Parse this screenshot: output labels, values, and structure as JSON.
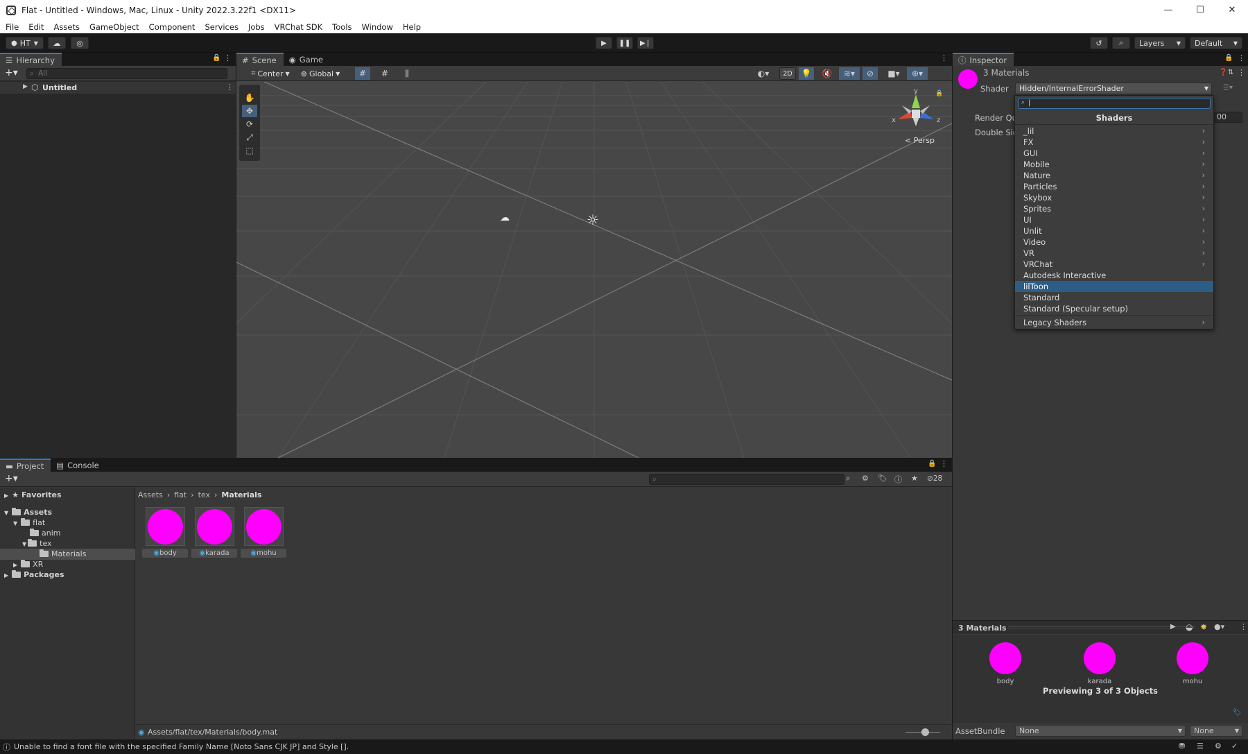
{
  "window": {
    "title": "Flat - Untitled - Windows, Mac, Linux - Unity 2022.3.22f1 <DX11>",
    "controls": [
      "—",
      "☐",
      "✕"
    ]
  },
  "menubar": [
    "File",
    "Edit",
    "Assets",
    "GameObject",
    "Component",
    "Services",
    "Jobs",
    "VRChat SDK",
    "Tools",
    "Window",
    "Help"
  ],
  "toolbar": {
    "account": "HT",
    "layers": "Layers",
    "layout": "Default"
  },
  "hierarchy": {
    "tab": "Hierarchy",
    "search_placeholder": "All",
    "scene": "Untitled"
  },
  "scene": {
    "tabs": [
      "Scene",
      "Game"
    ],
    "pivot": "Center",
    "space": "Global",
    "mode_2d": "2D",
    "persp": "< Persp",
    "gizmo_axes": {
      "y": "y",
      "x": "x",
      "z": "z"
    }
  },
  "inspector": {
    "tab": "Inspector",
    "title": "3 Materials",
    "shader_label": "Shader",
    "shader_value": "Hidden/InternalErrorShader",
    "render_queue_label": "Render Qu",
    "render_queue_value": "00",
    "double_sided_label": "Double Sid",
    "preview_title": "3 Materials",
    "preview_items": [
      "body",
      "karada",
      "mohu"
    ],
    "preview_status": "Previewing 3 of 3 Objects",
    "assetbundle_label": "AssetBundle",
    "assetbundle_value": "None",
    "assetbundle_variant": "None"
  },
  "shader_menu": {
    "header": "Shaders",
    "items": [
      {
        "label": "_lil",
        "sub": true
      },
      {
        "label": "FX",
        "sub": true
      },
      {
        "label": "GUI",
        "sub": true
      },
      {
        "label": "Mobile",
        "sub": true
      },
      {
        "label": "Nature",
        "sub": true
      },
      {
        "label": "Particles",
        "sub": true
      },
      {
        "label": "Skybox",
        "sub": true
      },
      {
        "label": "Sprites",
        "sub": true
      },
      {
        "label": "UI",
        "sub": true
      },
      {
        "label": "Unlit",
        "sub": true
      },
      {
        "label": "Video",
        "sub": true
      },
      {
        "label": "VR",
        "sub": true
      },
      {
        "label": "VRChat",
        "sub": true
      },
      {
        "label": "Autodesk Interactive",
        "sub": false
      },
      {
        "label": "lilToon",
        "sub": false,
        "selected": true
      },
      {
        "label": "Standard",
        "sub": false
      },
      {
        "label": "Standard (Specular setup)",
        "sub": false
      }
    ],
    "legacy": "Legacy Shaders",
    "chevron": "›"
  },
  "project": {
    "tabs": [
      "Project",
      "Console"
    ],
    "favorites": "Favorites",
    "tree": {
      "assets": "Assets",
      "flat": "flat",
      "anim": "anim",
      "tex": "tex",
      "materials": "Materials",
      "xr": "XR",
      "packages": "Packages"
    },
    "breadcrumb": [
      "Assets",
      "flat",
      "tex",
      "Materials"
    ],
    "assets": [
      "body",
      "karada",
      "mohu"
    ],
    "hidden_count": "28",
    "selected_path": "Assets/flat/tex/Materials/body.mat"
  },
  "status": {
    "message": "Unable to find a font file with the specified Family Name [Noto Sans CJK JP] and Style []."
  },
  "colors": {
    "material_error": "#ff00ff",
    "selection": "#2c5d87",
    "accent": "#3a79bb"
  }
}
